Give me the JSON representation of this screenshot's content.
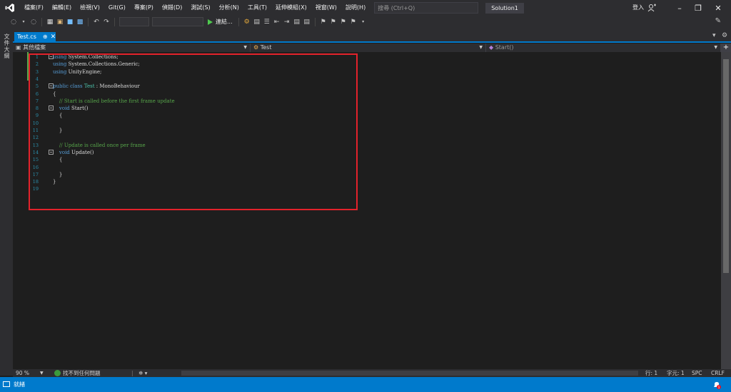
{
  "menu": {
    "items": [
      "檔案(F)",
      "編輯(E)",
      "檢視(V)",
      "Git(G)",
      "專案(P)",
      "偵錯(D)",
      "測試(S)",
      "分析(N)",
      "工具(T)",
      "延伸模組(X)",
      "視窗(W)",
      "說明(H)"
    ],
    "search_placeholder": "搜尋 (Ctrl+Q)",
    "solution_name": "Solution1",
    "login_label": "登入"
  },
  "toolbar": {
    "run_label": "連結..."
  },
  "side_panel": {
    "label": "文件大綱"
  },
  "tab": {
    "file_name": "Test.cs"
  },
  "navbar": {
    "scope": "其他檔案",
    "class": "Test",
    "member": "Start()"
  },
  "code": {
    "line_numbers": [
      "1",
      "2",
      "3",
      "4",
      "5",
      "6",
      "7",
      "8",
      "9",
      "10",
      "11",
      "12",
      "13",
      "14",
      "15",
      "16",
      "17",
      "18",
      "19"
    ],
    "lines": [
      [
        {
          "t": "using",
          "c": "kw"
        },
        {
          "t": " System.Collections;",
          "c": ""
        }
      ],
      [
        {
          "t": "using",
          "c": "kw"
        },
        {
          "t": " System.Collections.Generic;",
          "c": ""
        }
      ],
      [
        {
          "t": "using",
          "c": "kw"
        },
        {
          "t": " UnityEngine;",
          "c": ""
        }
      ],
      [],
      [
        {
          "t": "public class ",
          "c": "kw"
        },
        {
          "t": "Test",
          "c": "ty"
        },
        {
          "t": " : MonoBehaviour",
          "c": ""
        }
      ],
      [
        {
          "t": "{",
          "c": ""
        }
      ],
      [
        {
          "t": "    // Start is called before the first frame update",
          "c": "cm"
        }
      ],
      [
        {
          "t": "    void",
          "c": "kw"
        },
        {
          "t": " Start()",
          "c": ""
        }
      ],
      [
        {
          "t": "    {",
          "c": ""
        }
      ],
      [],
      [
        {
          "t": "    }",
          "c": ""
        }
      ],
      [],
      [
        {
          "t": "    // Update is called once per frame",
          "c": "cm"
        }
      ],
      [
        {
          "t": "    void",
          "c": "kw"
        },
        {
          "t": " Update()",
          "c": ""
        }
      ],
      [
        {
          "t": "    {",
          "c": ""
        }
      ],
      [],
      [
        {
          "t": "    }",
          "c": ""
        }
      ],
      [
        {
          "t": "}",
          "c": ""
        }
      ],
      []
    ]
  },
  "editor_status": {
    "zoom": "90 %",
    "issues": "找不到任何問題",
    "line": "行: 1",
    "column": "字元: 1",
    "spc": "SPC",
    "eol": "CRLF"
  },
  "statusbar": {
    "ready": "就緒"
  },
  "colors": {
    "accent": "#007acc",
    "highlight_box": "#e3222b"
  }
}
